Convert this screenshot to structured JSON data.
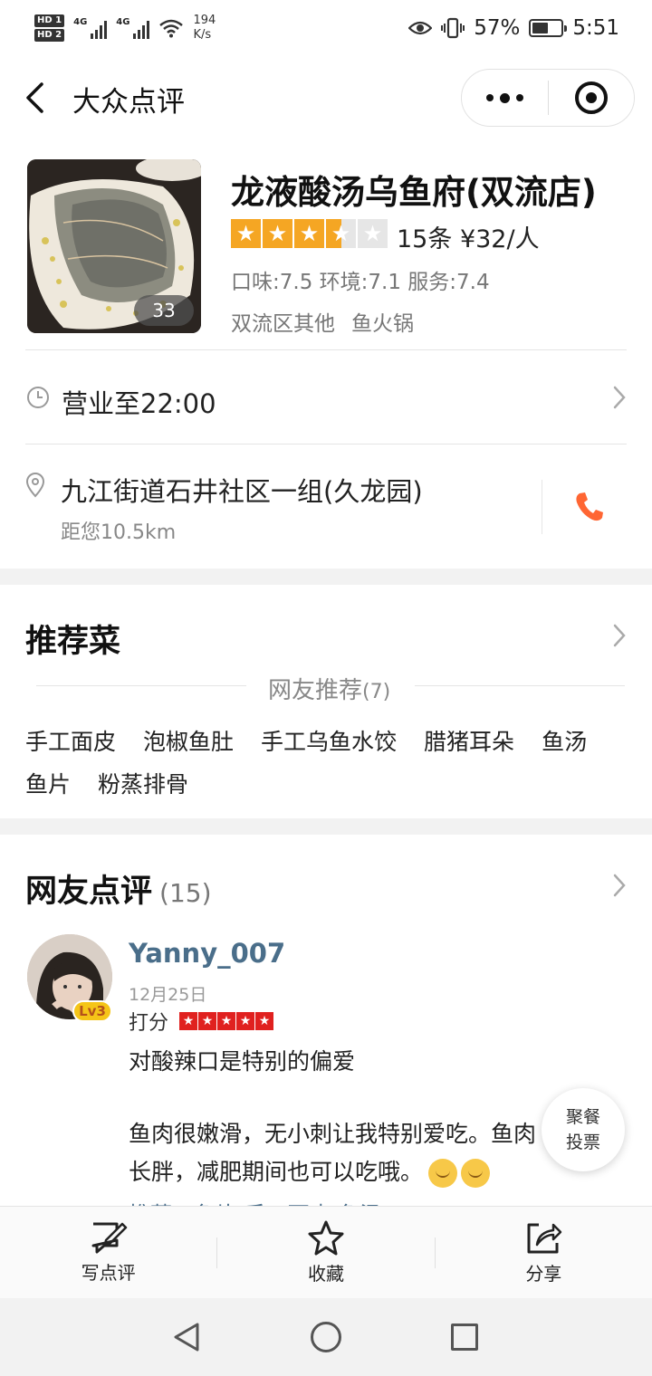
{
  "status_bar": {
    "hd1": "HD 1",
    "hd2": "HD 2",
    "net1": "4G",
    "net2": "4G",
    "speed_value": "194",
    "speed_unit": "K/s",
    "battery": "57%",
    "battery_level": 0.57,
    "time": "5:51"
  },
  "header": {
    "title": "大众点评"
  },
  "shop": {
    "photo_count": "33",
    "name": "龙液酸汤乌鱼府(双流店)",
    "rating_stars": 3.5,
    "reviews_price": "15条  ¥32/人",
    "scores": "口味:7.5 环境:7.1 服务:7.4",
    "tags": [
      "双流区其他",
      "鱼火锅"
    ]
  },
  "hours": {
    "text": "营业至22:00"
  },
  "address": {
    "text": "九江街道石井社区一组(久龙园)",
    "distance": "距您10.5km"
  },
  "recommended": {
    "title": "推荐菜",
    "subtitle": "网友推荐",
    "count": "(7)",
    "dishes_row1": [
      "手工面皮",
      "泡椒鱼肚",
      "手工乌鱼水饺",
      "腊猪耳朵",
      "鱼汤"
    ],
    "dishes_row2": [
      "鱼片",
      "粉蒸排骨"
    ]
  },
  "reviews": {
    "title": "网友点评",
    "count": "(15)",
    "item": {
      "level": "Lv3",
      "username": "Yanny_007",
      "date": "12月25日",
      "rate_label": "打分",
      "stars": 5,
      "line1": "对酸辣口是特别的偏爱",
      "line2": "鱼肉很嫩滑，无小刺让我特别爱吃。鱼肉",
      "line3": "长胖，减肥期间也可以吃哦。",
      "cut_line": "推荐：鱼片  手工面皮  鱼汤"
    }
  },
  "float_button": {
    "line1": "聚餐",
    "line2": "投票"
  },
  "actions": [
    {
      "label": "写点评"
    },
    {
      "label": "收藏"
    },
    {
      "label": "分享"
    }
  ]
}
